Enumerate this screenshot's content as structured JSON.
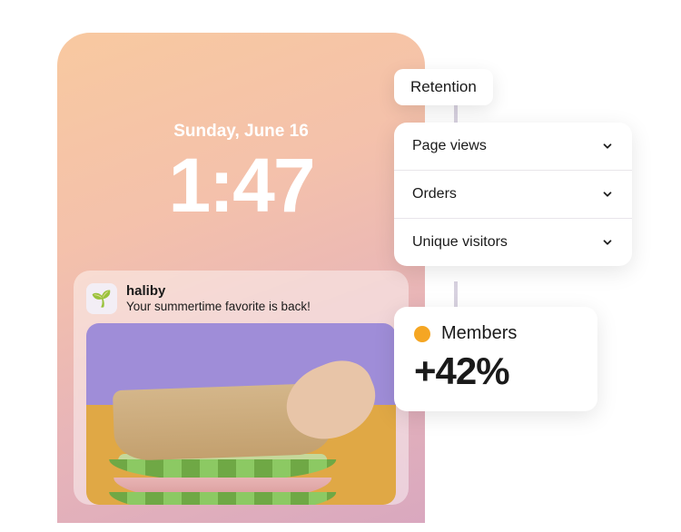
{
  "lock": {
    "date": "Sunday, June 16",
    "time": "1:47"
  },
  "notification": {
    "app_name": "haliby",
    "message": "Your summertime favorite is back!",
    "icon": "🌱"
  },
  "chip": {
    "label": "Retention"
  },
  "metrics": [
    {
      "label": "Page views"
    },
    {
      "label": "Orders"
    },
    {
      "label": "Unique visitors"
    }
  ],
  "members": {
    "label": "Members",
    "delta": "+42%",
    "dot_color": "#f5a623"
  }
}
